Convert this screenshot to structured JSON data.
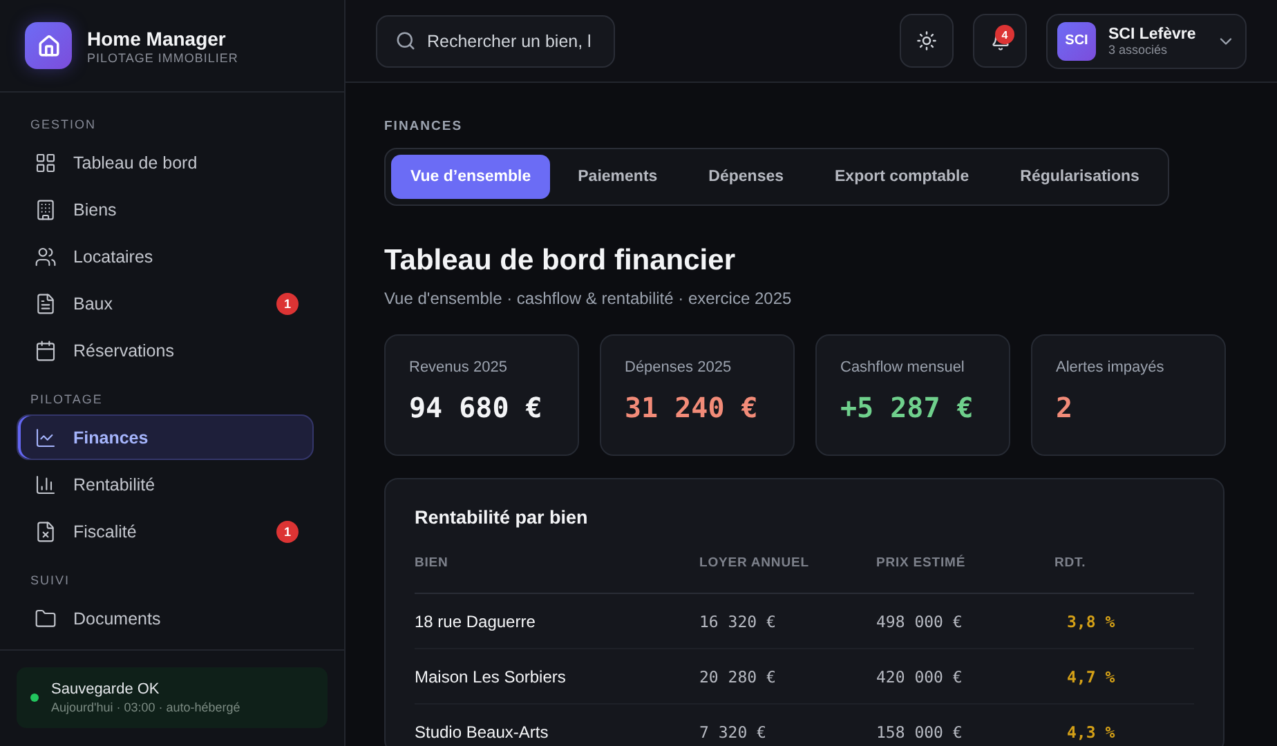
{
  "brand": {
    "name": "Home Manager",
    "tagline": "PILOTAGE IMMOBILIER"
  },
  "sidebar": {
    "sections": [
      {
        "title": "GESTION",
        "items": [
          {
            "label": "Tableau de bord",
            "selected": false
          },
          {
            "label": "Biens",
            "selected": false
          },
          {
            "label": "Locataires",
            "selected": false
          },
          {
            "label": "Baux",
            "selected": false,
            "badge": "1"
          },
          {
            "label": "Réservations",
            "selected": false
          }
        ]
      },
      {
        "title": "PILOTAGE",
        "items": [
          {
            "label": "Finances",
            "selected": true
          },
          {
            "label": "Rentabilité",
            "selected": false
          },
          {
            "label": "Fiscalité",
            "selected": false,
            "badge": "1"
          }
        ]
      },
      {
        "title": "SUIVI",
        "items": [
          {
            "label": "Documents",
            "selected": false
          }
        ]
      }
    ]
  },
  "backup": {
    "title": "Sauvegarde OK",
    "detail": "Aujourd'hui · 03:00 · auto-hébergé",
    "color": "#22c55e"
  },
  "topbar": {
    "search": {
      "placeholder": "Rechercher un bien, l"
    },
    "notifications": "4",
    "account": {
      "initials": "SCI",
      "name": "SCI Lefèvre",
      "detail": "3 associés"
    }
  },
  "section_label": "FINANCES",
  "tabs": [
    {
      "label": "Vue d’ensemble",
      "selected": true
    },
    {
      "label": "Paiements",
      "selected": false
    },
    {
      "label": "Dépenses",
      "selected": false
    },
    {
      "label": "Export comptable",
      "selected": false
    },
    {
      "label": "Régularisations",
      "selected": false
    }
  ],
  "title": "Tableau de bord financier",
  "subtitle": "Vue d'ensemble · cashflow & rentabilité · exercice 2025",
  "kpis": [
    {
      "label": "Revenus 2025",
      "value": "94 680 €",
      "color": "#f3f4f6"
    },
    {
      "label": "Dépenses 2025",
      "value": "31 240 €",
      "color": "#f28b78"
    },
    {
      "label": "Cashflow mensuel",
      "value": "+5 287 €",
      "color": "#6fd08c"
    },
    {
      "label": "Alertes impayés",
      "value": "2",
      "color": "#f28b78"
    }
  ],
  "table": {
    "title": "Rentabilité par bien",
    "columns": [
      "BIEN",
      "LOYER ANNUEL",
      "PRIX ESTIMÉ",
      "RDT."
    ],
    "rows": [
      [
        "18 rue Daguerre",
        "16 320 €",
        "498 000 €",
        "3,8 %"
      ],
      [
        "Maison Les Sorbiers",
        "20 280 €",
        "420 000 €",
        "4,7 %"
      ],
      [
        "Studio Beaux-Arts",
        "7 320 €",
        "158 000 €",
        "4,3 %"
      ]
    ]
  }
}
